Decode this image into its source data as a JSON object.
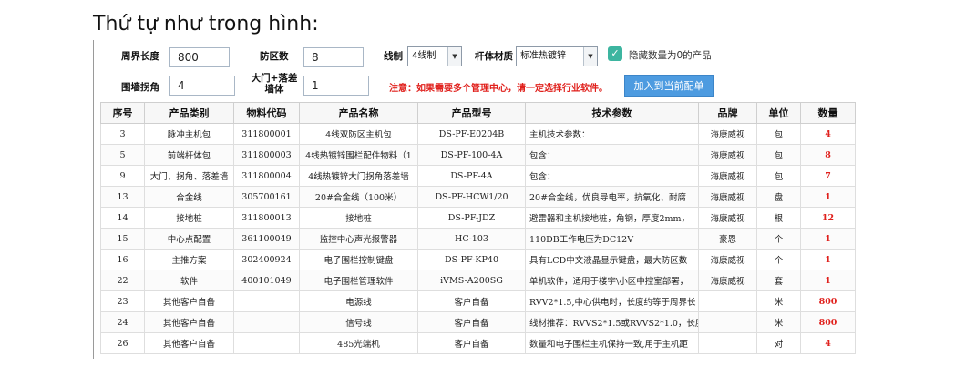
{
  "caption": "Thứ tự như trong hình:",
  "form": {
    "perimeter_label": "周界长度",
    "perimeter_value": "800",
    "zones_label": "防区数",
    "zones_value": "8",
    "wiring_label": "线制",
    "wiring_value": "4线制",
    "pole_label": "杆体材质",
    "pole_value": "标准热镀锌",
    "hide_zero_label": "隐藏数量为0的产品",
    "hide_zero_checked": true,
    "corner_label": "围墙拐角",
    "corner_value": "4",
    "gate_label": "大门+落差墙体",
    "gate_value": "1",
    "notice": "注意：如果需要多个管理中心，请一定选择行业软件。",
    "add_button": "加入到当前配单"
  },
  "table": {
    "headers": [
      "序号",
      "产品类别",
      "物料代码",
      "产品名称",
      "产品型号",
      "技术参数",
      "品牌",
      "单位",
      "数量"
    ],
    "rows": [
      [
        "3",
        "脉冲主机包",
        "311800001",
        "4线双防区主机包",
        "DS-PF-E0204B",
        "主机技术参数：",
        "海康威视",
        "包",
        "4"
      ],
      [
        "5",
        "前端杆体包",
        "311800003",
        "4线热镀锌围栏配件物料（1",
        "DS-PF-100-4A",
        "包含：",
        "海康威视",
        "包",
        "8"
      ],
      [
        "9",
        "大门、拐角、落差墙",
        "311800004",
        "4线热镀锌大门拐角落差墙",
        "DS-PF-4A",
        "包含：",
        "海康威视",
        "包",
        "7"
      ],
      [
        "13",
        "合金线",
        "305700161",
        "20#合金线（100米）",
        "DS-PF-HCW1/20",
        "20#合金线，优良导电率，抗氧化、耐腐",
        "海康威视",
        "盘",
        "1"
      ],
      [
        "14",
        "接地桩",
        "311800013",
        "接地桩",
        "DS-PF-JDZ",
        "避雷器和主机接地桩，角钢，厚度2mm，",
        "海康威视",
        "根",
        "12"
      ],
      [
        "15",
        "中心点配置",
        "361100049",
        "监控中心声光报警器",
        "HC-103",
        "110DB工作电压为DC12V",
        "豪恩",
        "个",
        "1"
      ],
      [
        "16",
        "主推方案",
        "302400924",
        "电子围栏控制键盘",
        "DS-PF-KP40",
        "具有LCD中文液晶显示键盘，最大防区数",
        "海康威视",
        "个",
        "1"
      ],
      [
        "22",
        "软件",
        "400101049",
        "电子围栏管理软件",
        "iVMS-A200SG",
        "单机软件，适用于楼宇\\小区中控室部署，",
        "海康威视",
        "套",
        "1"
      ],
      [
        "23",
        "其他客户自备",
        "",
        "电源线",
        "客户自备",
        "RVV2*1.5,中心供电时，长度约等于周界长",
        "",
        "米",
        "800"
      ],
      [
        "24",
        "其他客户自备",
        "",
        "信号线",
        "客户自备",
        "线材推荐：RVVS2*1.5或RVVS2*1.0，长度",
        "",
        "米",
        "800"
      ],
      [
        "26",
        "其他客户自备",
        "",
        "485光端机",
        "客户自备",
        "数量和电子围栏主机保持一致,用于主机距",
        "",
        "对",
        "4"
      ]
    ]
  }
}
